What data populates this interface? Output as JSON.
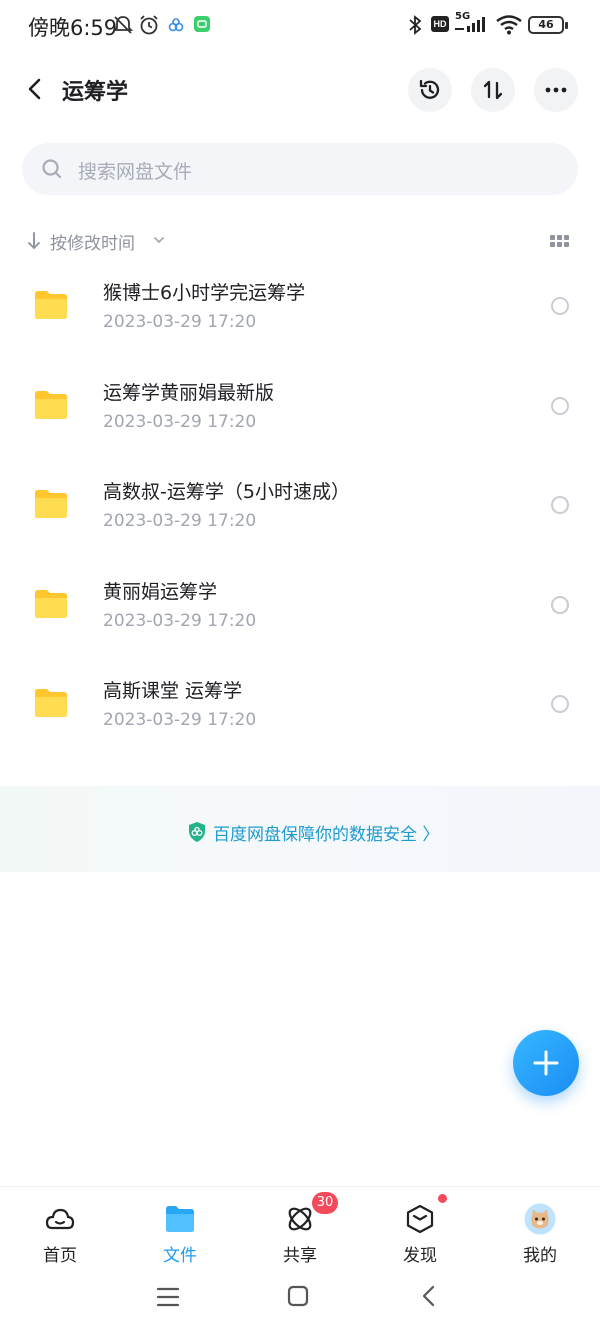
{
  "status_bar": {
    "time": "傍晚6:59",
    "network": "5G",
    "hd": "HD",
    "battery": "46"
  },
  "header": {
    "title": "运筹学"
  },
  "search": {
    "placeholder": "搜索网盘文件"
  },
  "sort": {
    "label": "按修改时间"
  },
  "files": [
    {
      "name": "猴博士6小时学完运筹学",
      "date": "2023-03-29  17:20"
    },
    {
      "name": "运筹学黄丽娟最新版",
      "date": "2023-03-29  17:20"
    },
    {
      "name": "高数叔-运筹学（5小时速成）",
      "date": "2023-03-29  17:20"
    },
    {
      "name": "黄丽娟运筹学",
      "date": "2023-03-29  17:20"
    },
    {
      "name": "高斯课堂  运筹学",
      "date": "2023-03-29  17:20"
    }
  ],
  "banner": {
    "text": "百度网盘保障你的数据安全 〉"
  },
  "bottom_nav": {
    "items": [
      {
        "label": "首页"
      },
      {
        "label": "文件"
      },
      {
        "label": "共享"
      },
      {
        "label": "发现"
      },
      {
        "label": "我的"
      }
    ],
    "share_badge": "30",
    "active_index": 1
  },
  "colors": {
    "accent": "#1e9bf5",
    "folder": "#ffd93b",
    "badge": "#f34b5c"
  },
  "icons": {
    "back": "chevron-left-icon",
    "history": "history-icon",
    "sort": "sort-arrows-icon",
    "more": "more-dots-icon",
    "search": "search-icon",
    "grid": "grid-view-icon",
    "folder": "folder-icon",
    "shield": "shield-icon",
    "add": "plus-icon"
  }
}
